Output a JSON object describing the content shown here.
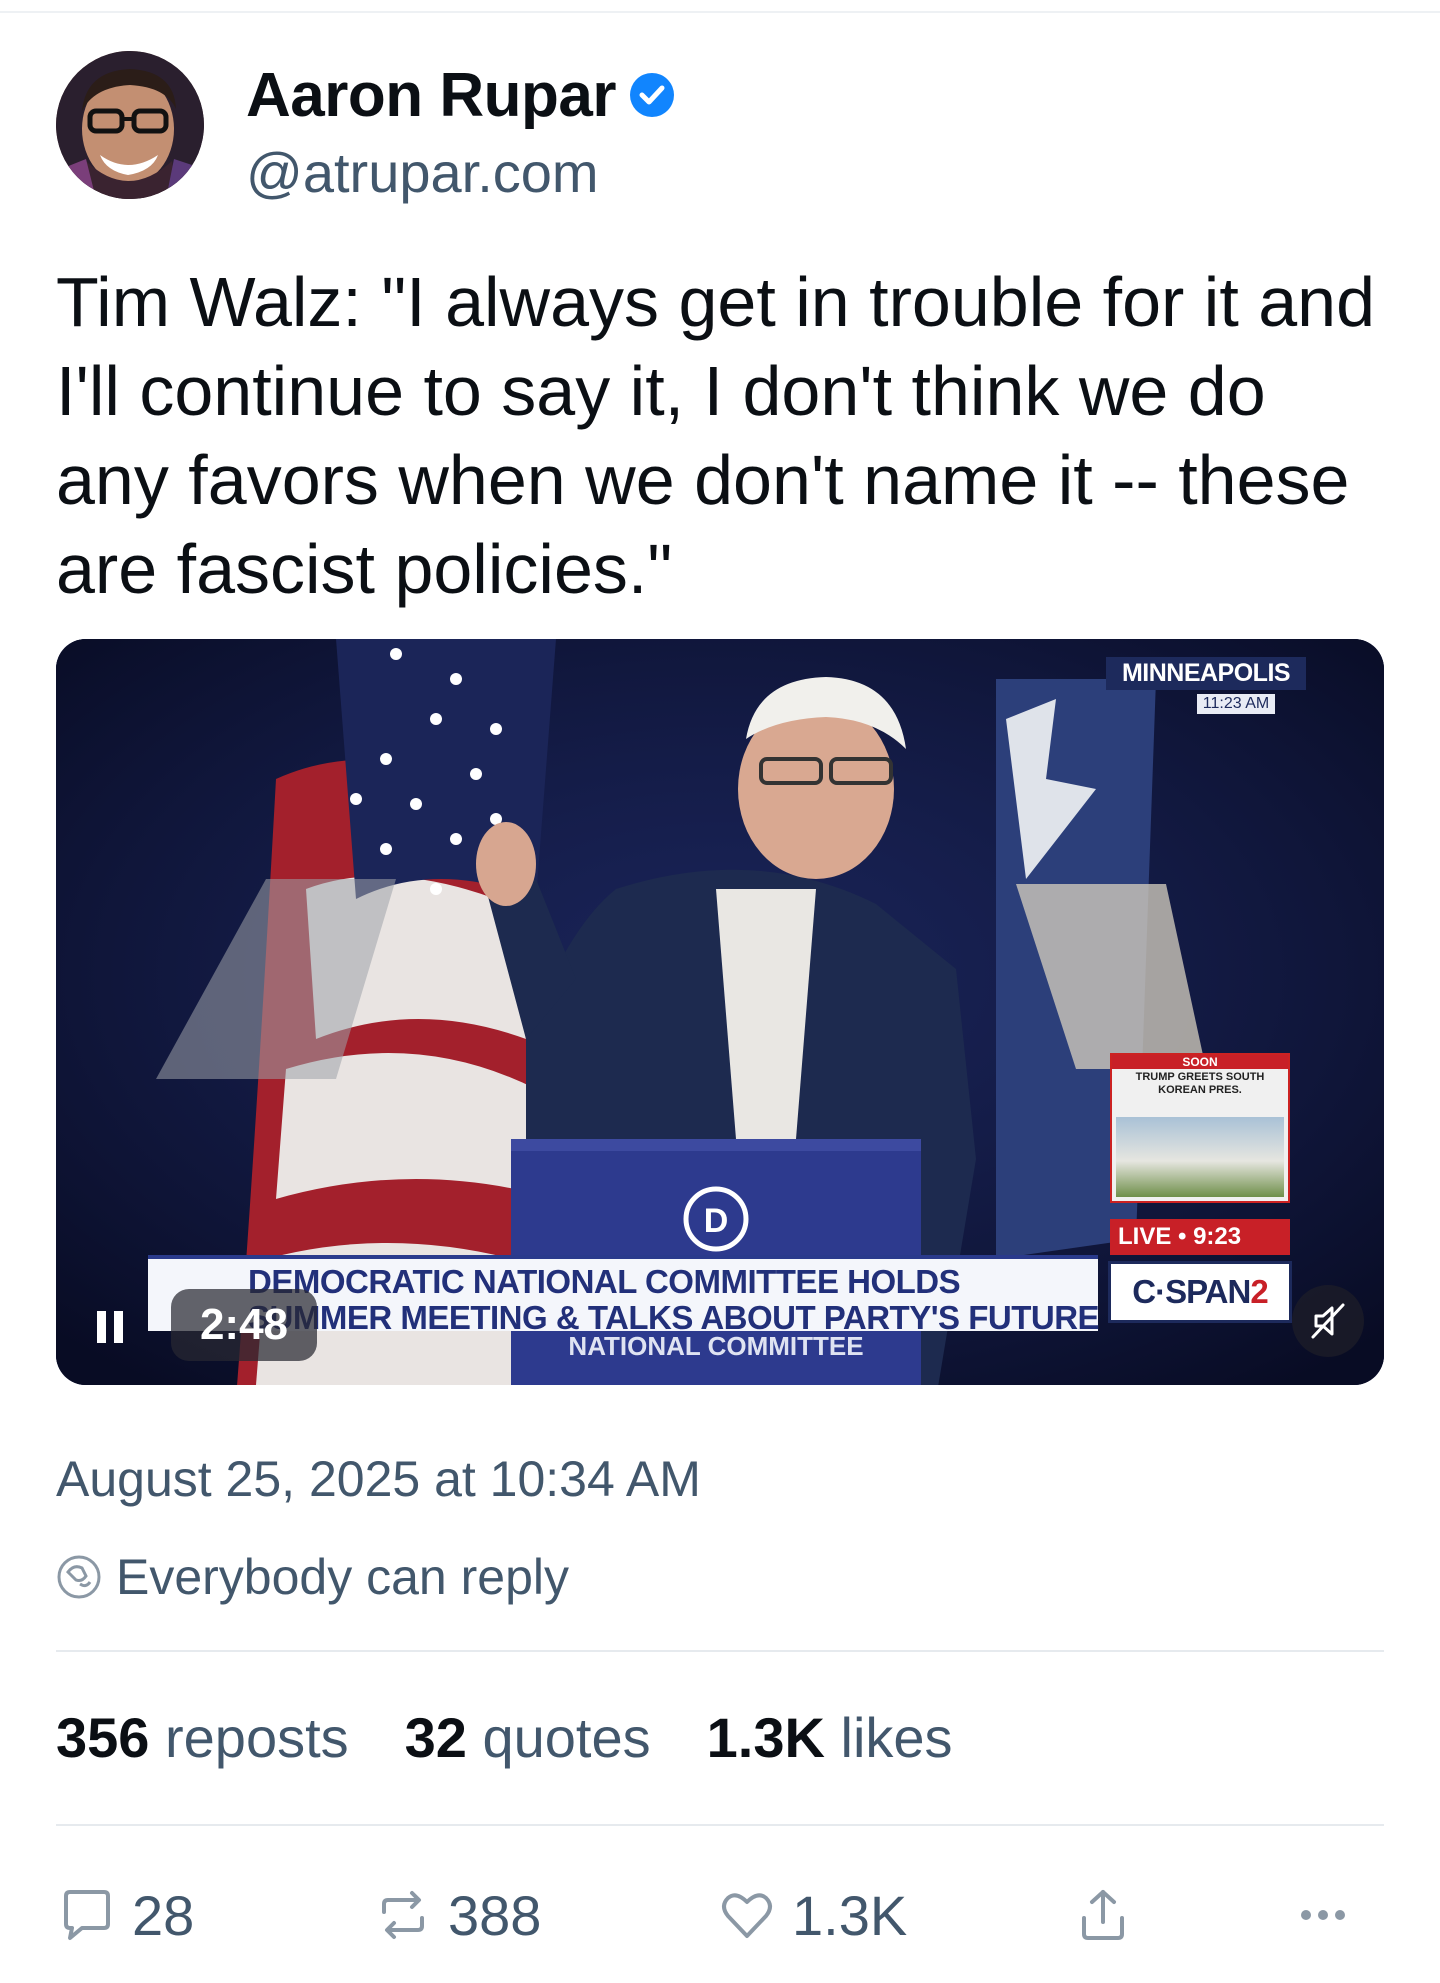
{
  "author": {
    "display_name": "Aaron Rupar",
    "handle": "@atrupar.com"
  },
  "post": {
    "text": "Tim Walz: \"I always get in trouble for it and I'll continue to say it, I don't think we do any favors when we don't name it -- these are fascist policies.\""
  },
  "video": {
    "duration": "2:48",
    "location": "MINNEAPOLIS",
    "location_time": "11:23 AM",
    "soon_label": "SOON",
    "soon_text": "TRUMP GREETS SOUTH KOREAN PRES.",
    "live_label": "LIVE • 9:23",
    "lower_third_line1": "DEMOCRATIC NATIONAL COMMITTEE HOLDS",
    "lower_third_line2": "SUMMER MEETING & TALKS ABOUT PARTY'S FUTURE",
    "podium_text": "NATIONAL COMMITTEE",
    "network_logo": "C·SPAN",
    "network_logo_number": "2",
    "podium_seal": "D"
  },
  "meta": {
    "timestamp": "August 25, 2025 at 10:34 AM",
    "reply_setting": "Everybody can reply"
  },
  "stats": {
    "reposts_count": "356",
    "reposts_label": "reposts",
    "quotes_count": "32",
    "quotes_label": "quotes",
    "likes_count": "1.3K",
    "likes_label": "likes"
  },
  "actions": {
    "reply_count": "28",
    "repost_count": "388",
    "like_count": "1.3K"
  },
  "colors": {
    "verified": "#1185fe",
    "secondary_text": "#42576c",
    "primary_text": "#0b0f14"
  },
  "icons": [
    "verified-icon",
    "pause-icon",
    "mute-icon",
    "reply-setting-icon",
    "reply-icon",
    "repost-icon",
    "like-icon",
    "share-icon",
    "more-icon"
  ]
}
